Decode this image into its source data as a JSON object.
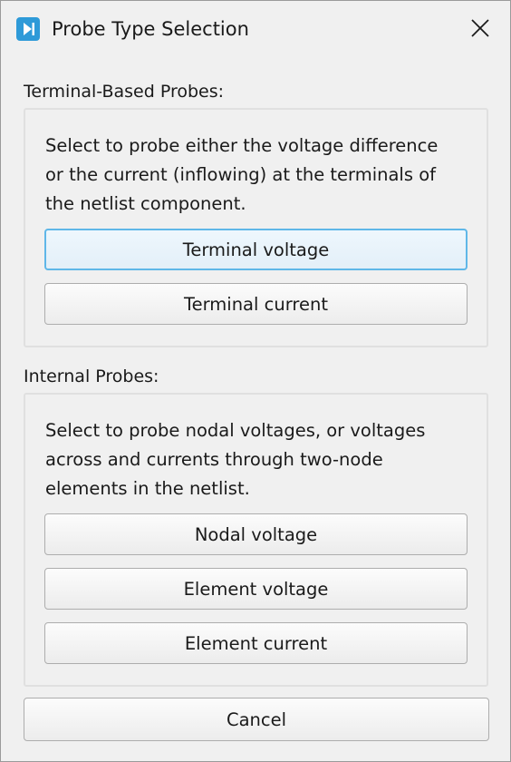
{
  "window": {
    "title": "Probe Type Selection",
    "icon": "play-to-end-icon",
    "close_icon": "close-icon",
    "accent": "#2e9ad8"
  },
  "terminal_section": {
    "label": "Terminal-Based Probes:",
    "description_lines": [
      "Select to probe either the voltage difference",
      "or the current (inflowing) at the terminals of",
      "the netlist component."
    ],
    "buttons": [
      "Terminal voltage",
      "Terminal current"
    ]
  },
  "internal_section": {
    "label": "Internal Probes:",
    "description_lines": [
      "Select to probe nodal voltages, or voltages",
      "across and currents through two-node",
      "elements in the netlist."
    ],
    "buttons": [
      "Nodal voltage",
      "Element voltage",
      "Element current"
    ]
  },
  "footer": {
    "cancel_label": "Cancel"
  }
}
